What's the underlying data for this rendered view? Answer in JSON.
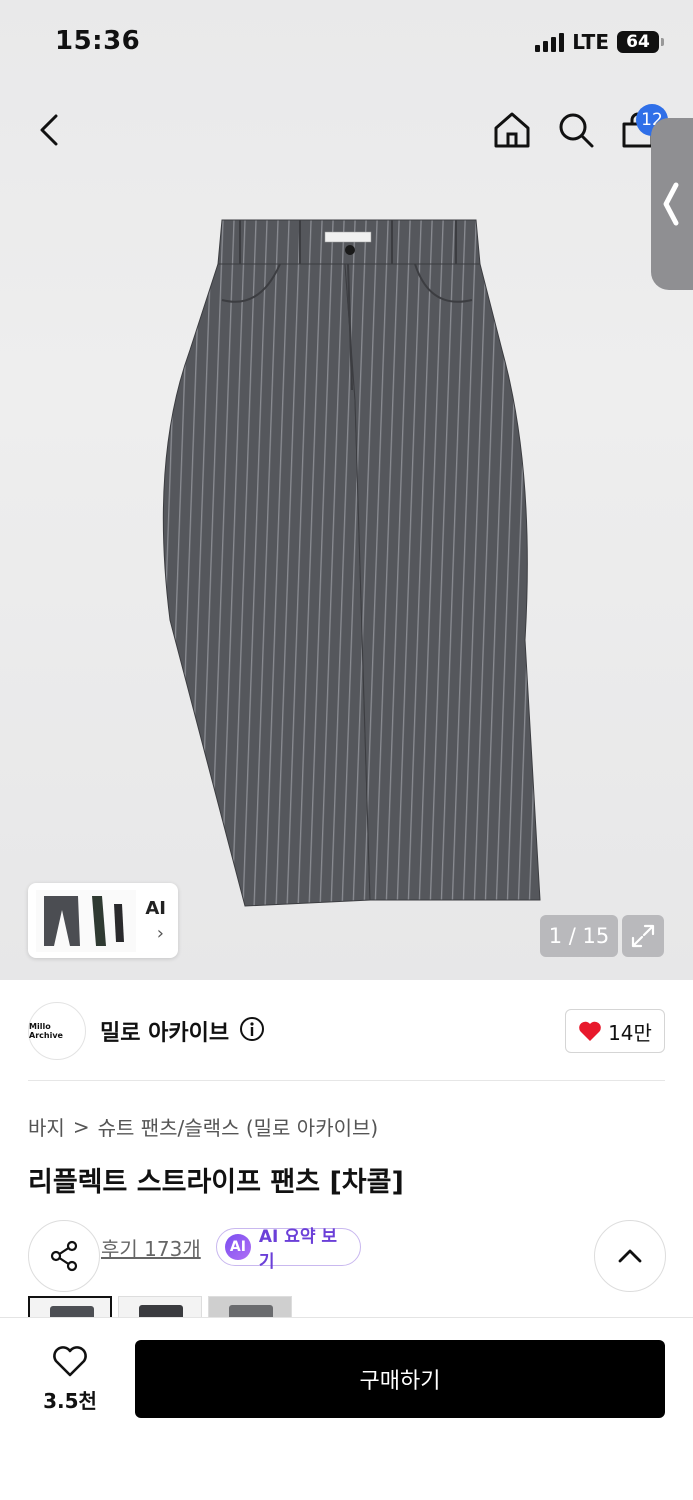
{
  "status_bar": {
    "time": "15:36",
    "network": "LTE",
    "battery": "64"
  },
  "header": {
    "cart_count": "12"
  },
  "gallery": {
    "counter": "1 / 15",
    "ai_thumb_label": "AI",
    "ai_thumb_chevron": "›"
  },
  "brand": {
    "logo_text": "Millo Archive",
    "name": "밀로 아카이브",
    "likes": "14만"
  },
  "breadcrumb": {
    "category": "바지",
    "separator": ">",
    "subcategory": "슈트 팬츠/슬랙스 (밀로 아카이브)"
  },
  "product": {
    "title": "리플렉트 스트라이프 팬츠 [차콜]",
    "reviews": "후기 173개",
    "ai_badge": "AI",
    "ai_summary": "AI 요약 보기"
  },
  "bottom_bar": {
    "wish_count": "3.5천",
    "buy_label": "구매하기"
  },
  "colors": {
    "accent_blue": "#2f6fe8",
    "ai_purple": "#6b3fd8",
    "heart_red": "#e8192c"
  }
}
